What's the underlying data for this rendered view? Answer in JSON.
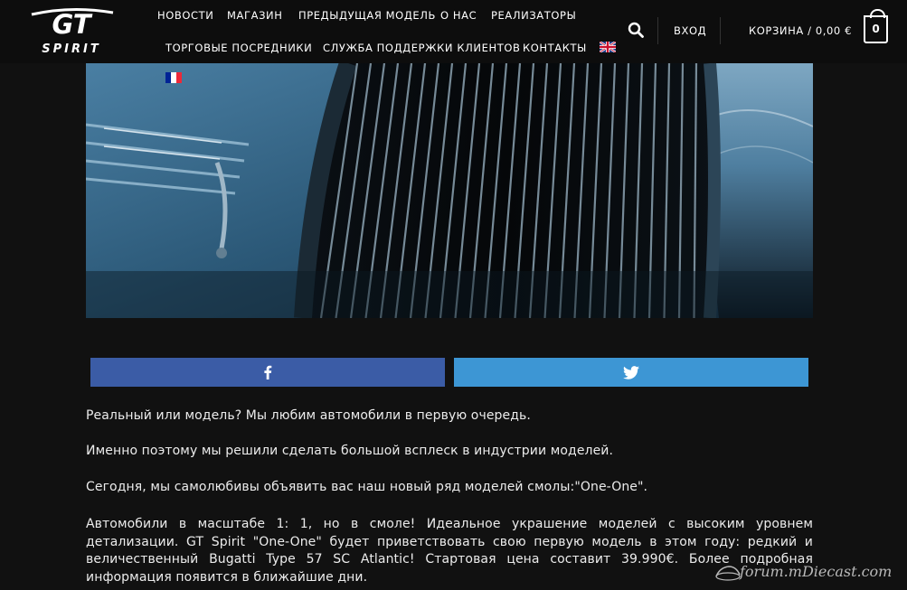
{
  "header": {
    "logo_top": "GT",
    "logo_bottom": "SPIRIT",
    "nav": {
      "news": "НОВОСТИ",
      "shop": "МАГАЗИН",
      "prev_model": "ПРЕДЫДУЩАЯ МОДЕЛЬ",
      "about": "О НАС",
      "resellers": "РЕАЛИЗАТОРЫ",
      "dealers": "ТОРГОВЫЕ ПОСРЕДНИКИ",
      "support": "СЛУЖБА ПОДДЕРЖКИ КЛИЕНТОВ",
      "contacts": "КОНТАКТЫ"
    },
    "login": "ВХОД",
    "cart_label": "КОРЗИНА / 0,00 €",
    "cart_count": "0",
    "search_icon": "search-icon",
    "flags": [
      "uk-flag",
      "france-flag"
    ]
  },
  "share": {
    "facebook_icon": "facebook-icon",
    "twitter_icon": "twitter-icon",
    "facebook_color": "#3b5ca6",
    "twitter_color": "#3d96d4"
  },
  "article": {
    "p1": "Реальный или модель? Мы любим автомобили в первую очередь.",
    "p2": "Именно поэтому мы решили сделать большой всплеск в индустрии моделей.",
    "p3": "Сегодня, мы самолюбивы объявить вас наш новый ряд моделей смолы:\"One-One\".",
    "p4": "Автомобили в масштабе 1: 1, но в смоле! Идеальное украшение моделей с высоким уровнем детализации. GT Spirit \"One-One\" будет приветствовать свою первую модель в этом году: редкий и величественный Bugatti Type 57 SC Atlantic! Стартовая цена составит 39.990€. Более подробная информация появится в ближайшие дни."
  },
  "watermark": "forum.mDiecast.com"
}
